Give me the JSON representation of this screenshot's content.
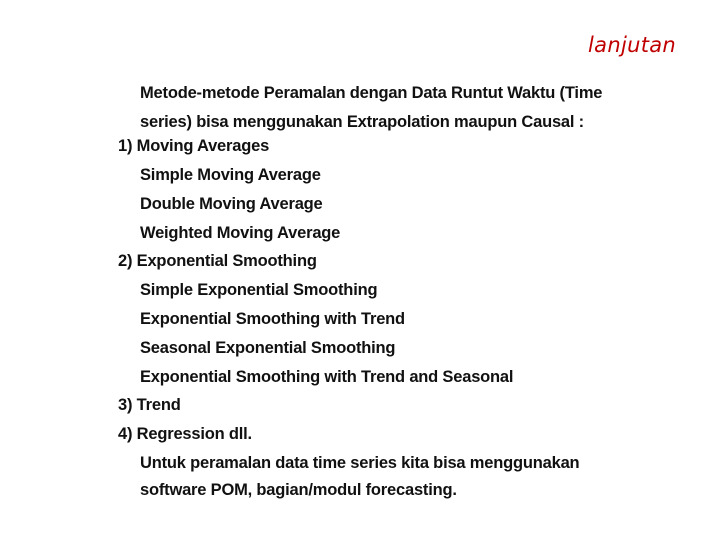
{
  "slide": {
    "title": "lanjutan",
    "title_color": "#c00000",
    "intro": [
      "Metode-metode Peramalan dengan Data  Runtut Waktu (Time",
      "series) bisa menggunakan Extrapolation maupun Causal :"
    ],
    "items": [
      {
        "label": "1) Moving Averages",
        "subitems": [
          "Simple Moving Average",
          "Double Moving Average",
          "Weighted Moving Average"
        ]
      },
      {
        "label": "2) Exponential Smoothing",
        "subitems": [
          "Simple Exponential Smoothing",
          "Exponential Smoothing with Trend",
          "Seasonal Exponential Smoothing",
          "Exponential Smoothing with Trend and Seasonal"
        ]
      },
      {
        "label": "3) Trend",
        "subitems": []
      },
      {
        "label": "4) Regression dll.",
        "subitems": []
      }
    ],
    "closing": [
      "Untuk peramalan data time series kita bisa menggunakan",
      "software POM, bagian/modul forecasting."
    ]
  }
}
